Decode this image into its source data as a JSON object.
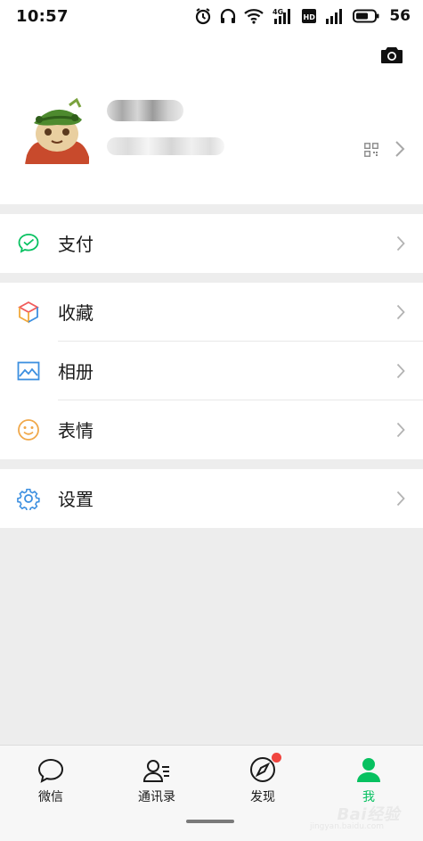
{
  "status_bar": {
    "time": "10:57",
    "battery": "56",
    "network_label": "4G"
  },
  "profile": {
    "name_blurred": true,
    "id_blurred": true,
    "icons": [
      "camera-icon",
      "qr-code-icon",
      "chevron-right-icon"
    ]
  },
  "menu": {
    "pay": {
      "label": "支付",
      "icon": "wechat-pay-icon",
      "color": "#07c160"
    },
    "favorites": {
      "label": "收藏",
      "icon": "cube-icon"
    },
    "album": {
      "label": "相册",
      "icon": "photo-album-icon",
      "color": "#3c8fe0"
    },
    "stickers": {
      "label": "表情",
      "icon": "smiley-icon",
      "color": "#f0a84a"
    },
    "settings": {
      "label": "设置",
      "icon": "gear-icon",
      "color": "#3c8fe0"
    }
  },
  "tabs": [
    {
      "label": "微信",
      "icon": "chat-bubble-icon",
      "active": false
    },
    {
      "label": "通讯录",
      "icon": "contacts-icon",
      "active": false
    },
    {
      "label": "发现",
      "icon": "compass-icon",
      "active": false,
      "badge": true
    },
    {
      "label": "我",
      "icon": "person-icon",
      "active": true
    }
  ],
  "watermark": {
    "text": "Bai",
    "text2": "经验",
    "sub": "jingyan.baidu.com"
  },
  "colors": {
    "active": "#07c160",
    "badge": "#f0453f",
    "background": "#ededed"
  }
}
